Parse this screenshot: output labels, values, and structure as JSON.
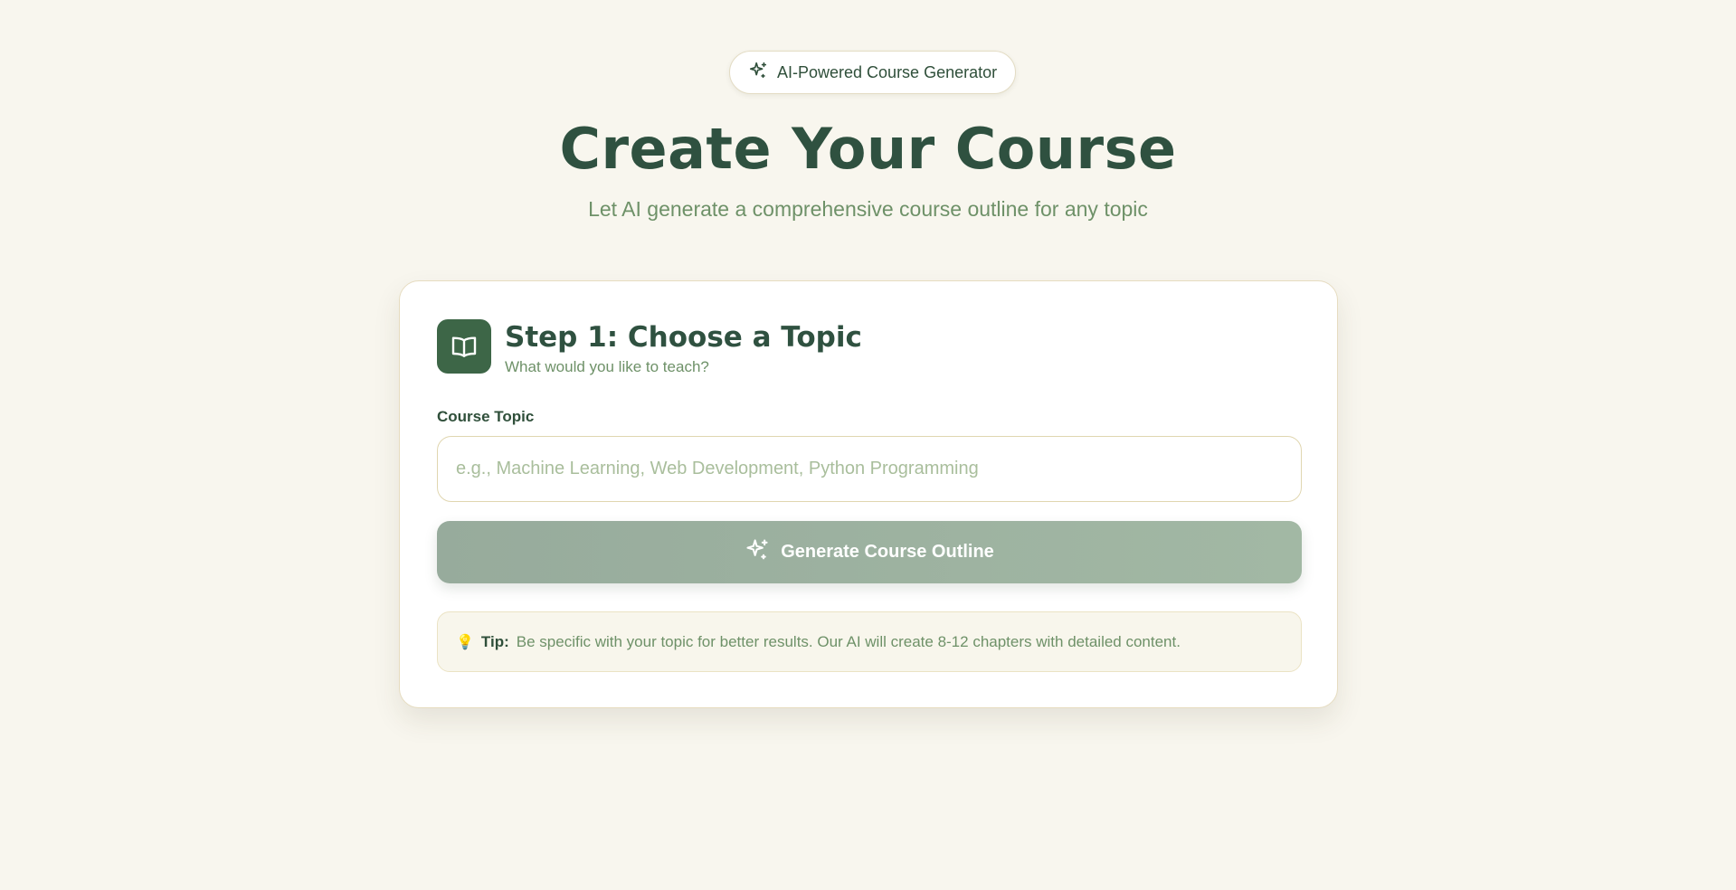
{
  "badge": {
    "label": "AI-Powered Course Generator",
    "icon": "sparkles-icon"
  },
  "header": {
    "title": "Create Your Course",
    "subtitle": "Let AI generate a comprehensive course outline for any topic"
  },
  "step": {
    "icon": "book-open-icon",
    "title": "Step 1: Choose a Topic",
    "subtitle": "What would you like to teach?"
  },
  "form": {
    "label": "Course Topic",
    "value": "",
    "placeholder": "e.g., Machine Learning, Web Development, Python Programming",
    "button_label": "Generate Course Outline",
    "button_icon": "sparkles-icon"
  },
  "tip": {
    "icon": "lightbulb-icon",
    "label": "Tip:",
    "text": "Be specific with your topic for better results. Our AI will create 8-12 chapters with detailed content."
  },
  "colors": {
    "background": "#f8f6ee",
    "primary": "#2f5140",
    "accent": "#3d6647",
    "muted_text": "#6e9168",
    "button_disabled": "#9fb3a1"
  }
}
